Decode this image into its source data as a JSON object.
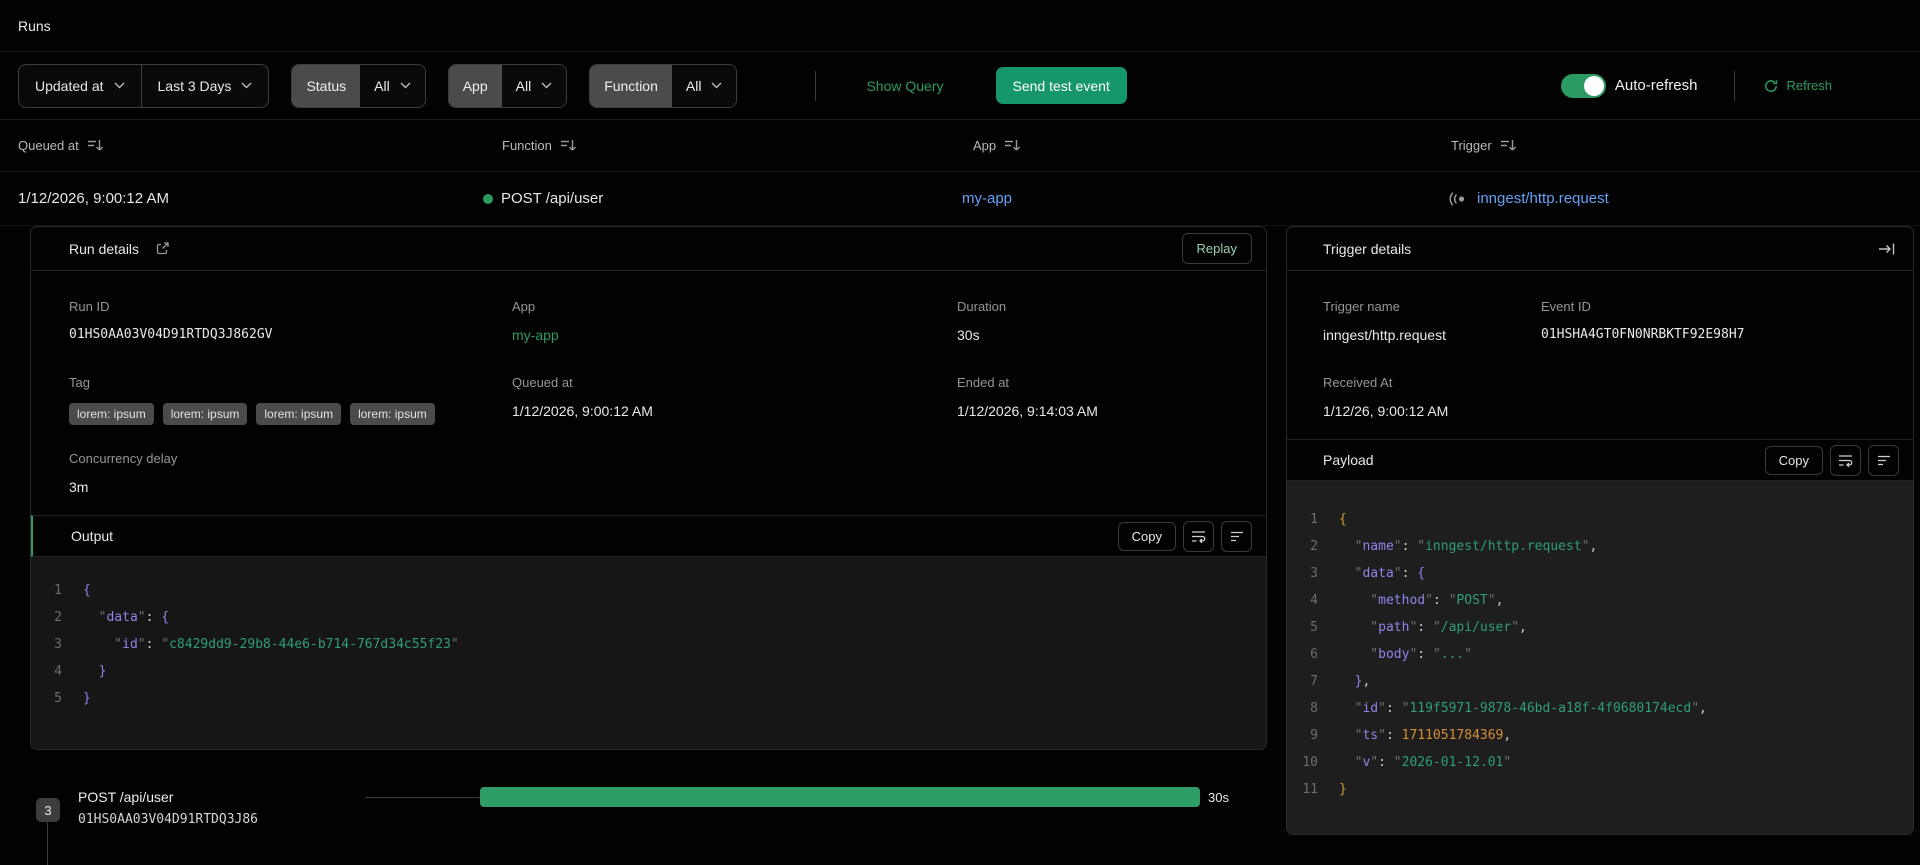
{
  "page": {
    "title": "Runs"
  },
  "colors": {
    "accent_green": "#2c9b63",
    "button_green": "#16976b",
    "bar_green": "#2f9e66",
    "link_blue": "#64a1f4"
  },
  "icons": [
    "chevron-down-icon",
    "sort-icon",
    "status-dot",
    "webhook-icon",
    "external-link-icon",
    "collapse-right-icon",
    "wrap-text-icon",
    "align-left-icon",
    "refresh-icon"
  ],
  "filters": {
    "sort_field": "Updated at",
    "time_range": "Last 3 Days",
    "status": {
      "label": "Status",
      "value": "All"
    },
    "app": {
      "label": "App",
      "value": "All"
    },
    "function": {
      "label": "Function",
      "value": "All"
    },
    "show_query": "Show Query",
    "send_test_event": "Send test event",
    "auto_refresh_label": "Auto-refresh",
    "refresh_label": "Refresh"
  },
  "table": {
    "headers": [
      "Queued at",
      "Function",
      "App",
      "Trigger"
    ],
    "row": {
      "queued_at": "1/12/2026, 9:00:12 AM",
      "function": "POST /api/user",
      "app": "my-app",
      "trigger": "inngest/http.request"
    }
  },
  "run_details": {
    "title": "Run details",
    "replay_label": "Replay",
    "run_id_label": "Run ID",
    "run_id": "01HS0AA03V04D91RTDQ3J862GV",
    "app_label": "App",
    "app": "my-app",
    "duration_label": "Duration",
    "duration": "30s",
    "tag_label": "Tag",
    "tags": [
      "lorem: ipsum",
      "lorem: ipsum",
      "lorem: ipsum",
      "lorem: ipsum"
    ],
    "queued_at_label": "Queued at",
    "queued_at": "1/12/2026, 9:00:12 AM",
    "ended_at_label": "Ended at",
    "ended_at": "1/12/2026, 9:14:03 AM",
    "concurrency_label": "Concurrency delay",
    "concurrency": "3m",
    "output": {
      "title": "Output",
      "copy_label": "Copy",
      "lines": [
        [
          [
            "b2",
            "{"
          ]
        ],
        [
          [
            "q",
            "  \""
          ],
          [
            "k",
            "data"
          ],
          [
            "q",
            "\""
          ],
          [
            "p",
            ": "
          ],
          [
            "b2",
            "{"
          ]
        ],
        [
          [
            "q",
            "    \""
          ],
          [
            "k",
            "id"
          ],
          [
            "q",
            "\""
          ],
          [
            "p",
            ": "
          ],
          [
            "q",
            "\""
          ],
          [
            "s",
            "c8429dd9-29b8-44e6-b714-767d34c55f23"
          ],
          [
            "q",
            "\""
          ]
        ],
        [
          [
            "b2",
            "  }"
          ]
        ],
        [
          [
            "b2",
            "}"
          ]
        ]
      ]
    }
  },
  "trigger_details": {
    "title": "Trigger details",
    "trigger_name_label": "Trigger name",
    "trigger_name": "inngest/http.request",
    "event_id_label": "Event ID",
    "event_id": "01HSHA4GT0FN0NRBKTF92E98H7",
    "received_at_label": "Received At",
    "received_at": "1/12/26, 9:00:12 AM",
    "payload": {
      "title": "Payload",
      "copy_label": "Copy",
      "lines": [
        [
          [
            "b1",
            "{"
          ]
        ],
        [
          [
            "q",
            "  \""
          ],
          [
            "k",
            "name"
          ],
          [
            "q",
            "\""
          ],
          [
            "p",
            ": "
          ],
          [
            "q",
            "\""
          ],
          [
            "s",
            "inngest/http.request"
          ],
          [
            "q",
            "\""
          ],
          [
            "p",
            ","
          ]
        ],
        [
          [
            "q",
            "  \""
          ],
          [
            "k",
            "data"
          ],
          [
            "q",
            "\""
          ],
          [
            "p",
            ": "
          ],
          [
            "b2",
            "{"
          ]
        ],
        [
          [
            "q",
            "    \""
          ],
          [
            "k",
            "method"
          ],
          [
            "q",
            "\""
          ],
          [
            "p",
            ": "
          ],
          [
            "q",
            "\""
          ],
          [
            "s",
            "POST"
          ],
          [
            "q",
            "\""
          ],
          [
            "p",
            ","
          ]
        ],
        [
          [
            "q",
            "    \""
          ],
          [
            "k",
            "path"
          ],
          [
            "q",
            "\""
          ],
          [
            "p",
            ": "
          ],
          [
            "q",
            "\""
          ],
          [
            "s",
            "/api/user"
          ],
          [
            "q",
            "\""
          ],
          [
            "p",
            ","
          ]
        ],
        [
          [
            "q",
            "    \""
          ],
          [
            "k",
            "body"
          ],
          [
            "q",
            "\""
          ],
          [
            "p",
            ": "
          ],
          [
            "q",
            "\""
          ],
          [
            "s",
            "..."
          ],
          [
            "q",
            "\""
          ]
        ],
        [
          [
            "b2",
            "  }"
          ],
          [
            "p",
            ","
          ]
        ],
        [
          [
            "q",
            "  \""
          ],
          [
            "k",
            "id"
          ],
          [
            "q",
            "\""
          ],
          [
            "p",
            ": "
          ],
          [
            "q",
            "\""
          ],
          [
            "s",
            "119f5971-9878-46bd-a18f-4f0680174ecd"
          ],
          [
            "q",
            "\""
          ],
          [
            "p",
            ","
          ]
        ],
        [
          [
            "q",
            "  \""
          ],
          [
            "k",
            "ts"
          ],
          [
            "q",
            "\""
          ],
          [
            "p",
            ": "
          ],
          [
            "n",
            "1711051784369"
          ],
          [
            "p",
            ","
          ]
        ],
        [
          [
            "q",
            "  \""
          ],
          [
            "k",
            "v"
          ],
          [
            "q",
            "\""
          ],
          [
            "p",
            ": "
          ],
          [
            "q",
            "\""
          ],
          [
            "s",
            "2026-01-12.01"
          ],
          [
            "q",
            "\""
          ]
        ],
        [
          [
            "b1",
            "}"
          ]
        ]
      ]
    }
  },
  "timeline": {
    "badge": "3",
    "step_name": "POST /api/user",
    "step_id": "01HS0AA03V04D91RTDQ3J86",
    "duration": "30s"
  }
}
